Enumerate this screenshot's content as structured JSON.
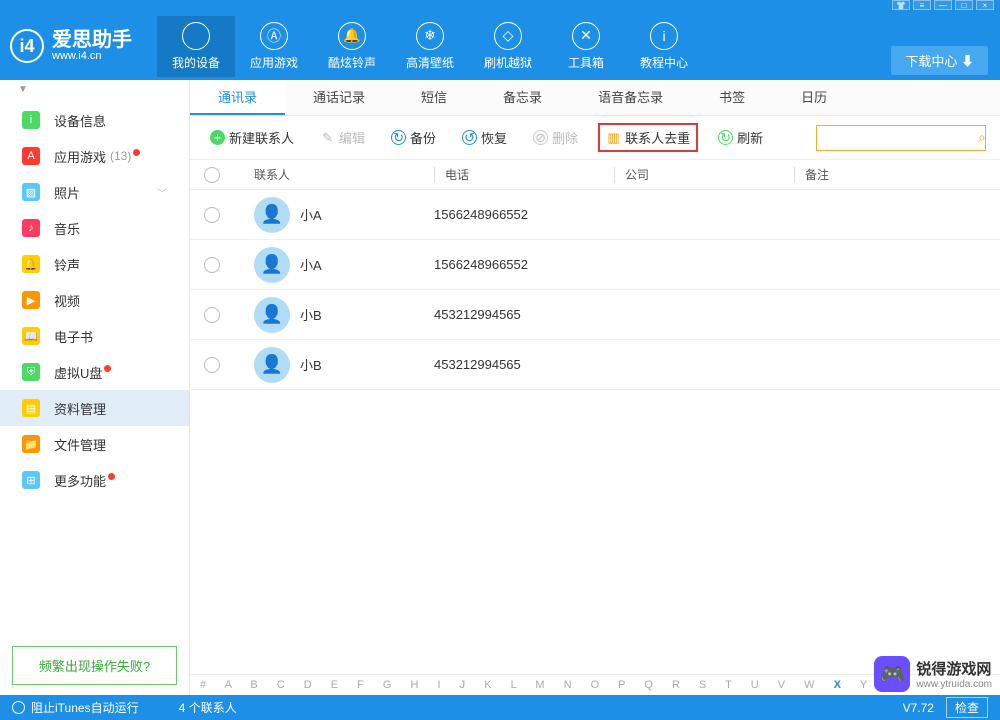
{
  "window": {
    "controls": [
      "👕",
      "≡",
      "—",
      "□",
      "×"
    ]
  },
  "logo": {
    "icon": "i4",
    "title": "爱思助手",
    "sub": "www.i4.cn"
  },
  "nav": [
    {
      "icon": "",
      "label": "我的设备",
      "active": true
    },
    {
      "icon": "Ⓐ",
      "label": "应用游戏"
    },
    {
      "icon": "🔔",
      "label": "酷炫铃声"
    },
    {
      "icon": "❄",
      "label": "高清壁纸"
    },
    {
      "icon": "◇",
      "label": "刷机越狱"
    },
    {
      "icon": "✕",
      "label": "工具箱"
    },
    {
      "icon": "i",
      "label": "教程中心"
    }
  ],
  "download_btn": "下载中心 ⬇",
  "sidebar": [
    {
      "label": "设备信息",
      "color": "#4cd964",
      "icon": "i"
    },
    {
      "label": "应用游戏",
      "color": "#ff3b30",
      "icon": "A",
      "count": "(13)",
      "dot": true
    },
    {
      "label": "照片",
      "color": "#5ac8fa",
      "icon": "▨",
      "chev": true
    },
    {
      "label": "音乐",
      "color": "#ff3b63",
      "icon": "♪"
    },
    {
      "label": "铃声",
      "color": "#ffcc00",
      "icon": "🔔"
    },
    {
      "label": "视频",
      "color": "#ff9500",
      "icon": "▶"
    },
    {
      "label": "电子书",
      "color": "#ffcc00",
      "icon": "📖"
    },
    {
      "label": "虚拟U盘",
      "color": "#4cd964",
      "icon": "⛨",
      "dot": true
    },
    {
      "label": "资料管理",
      "color": "#ffcc00",
      "icon": "▤",
      "active": true
    },
    {
      "label": "文件管理",
      "color": "#ff9500",
      "icon": "📁"
    },
    {
      "label": "更多功能",
      "color": "#5ac8fa",
      "icon": "⊞",
      "dot": true
    }
  ],
  "faq_link": "频繁出现操作失败?",
  "sub_tabs": [
    "通讯录",
    "通话记录",
    "短信",
    "备忘录",
    "语音备忘录",
    "书签",
    "日历"
  ],
  "toolbar": {
    "new": "新建联系人",
    "edit": "编辑",
    "backup": "备份",
    "restore": "恢复",
    "delete": "删除",
    "dedupe": "联系人去重",
    "refresh": "刷新"
  },
  "columns": {
    "name": "联系人",
    "phone": "电话",
    "company": "公司",
    "note": "备注"
  },
  "contacts": [
    {
      "name": "小A",
      "phone": "1566248966552"
    },
    {
      "name": "小A",
      "phone": "1566248966552"
    },
    {
      "name": "小B",
      "phone": "453212994565"
    },
    {
      "name": "小B",
      "phone": "453212994565"
    }
  ],
  "alpha_index": "# A B C D E F G H I J K L M N O P Q R S T U V W",
  "alpha_active": "X",
  "alpha_tail": " Y Z",
  "status": {
    "itunes": "阻止iTunes自动运行",
    "count": "4 个联系人",
    "version": "V7.72",
    "check": "检查"
  },
  "watermark": {
    "title": "锐得游戏网",
    "sub": "www.ytruida.com",
    "icon": "🎮"
  }
}
